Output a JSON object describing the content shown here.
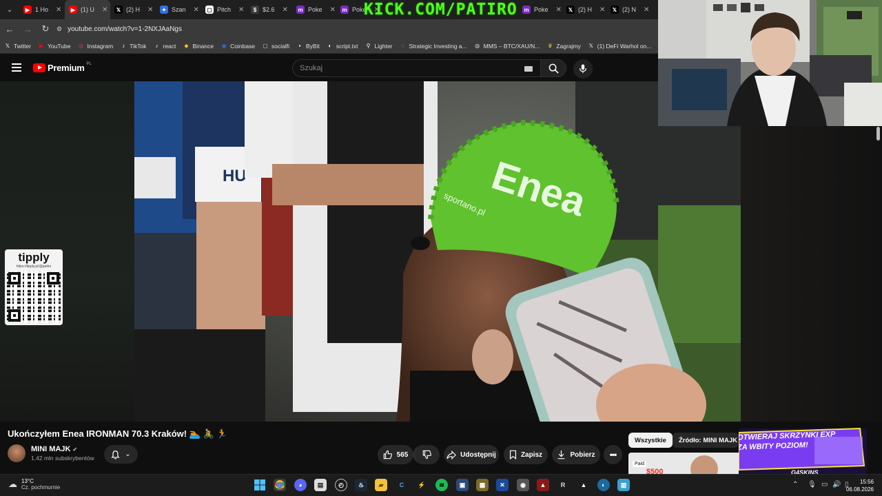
{
  "browser": {
    "tabs": [
      {
        "label": "1 Ho",
        "icon": "youtube",
        "color": "#ff0000"
      },
      {
        "label": "(1) U",
        "icon": "youtube",
        "color": "#ff0000",
        "active": true
      },
      {
        "label": "(2) H",
        "icon": "x",
        "color": "#000000"
      },
      {
        "label": "Szan",
        "icon": "star",
        "color": "#2f6fe0"
      },
      {
        "label": "Pitch",
        "icon": "doc",
        "color": "#ffffff"
      },
      {
        "label": "$2.6",
        "icon": "circle",
        "color": "#3c3c3c"
      },
      {
        "label": "Poke",
        "icon": "m",
        "color": "#7b2cbf"
      },
      {
        "label": "Poke",
        "icon": "m",
        "color": "#7b2cbf"
      },
      {
        "label": "Poke",
        "icon": "m",
        "color": "#7b2cbf"
      },
      {
        "label": "(2) H",
        "icon": "x",
        "color": "#000000"
      },
      {
        "label": "(2) N",
        "icon": "x",
        "color": "#000000"
      }
    ],
    "overlay_text": "KICK.COM/PATIRO",
    "url": "youtube.com/watch?v=1-2NXJAaNgs",
    "bookmarks": [
      "Twitter",
      "YouTube",
      "Instagram",
      "TikTok",
      "react",
      "Binance",
      "Coinbase",
      "socialfi",
      "ByBit",
      "script.txt",
      "Lighter",
      "Strategic Investing a...",
      "MMS – BTC/XAU/N...",
      "Zagrajmy",
      "(1) DeFi Warhol on..."
    ]
  },
  "youtube": {
    "logo_text": "Premium",
    "region": "PL",
    "search_placeholder": "Szukaj",
    "video_title": "Ukończyłem Enea IRONMAN 70.3 Kraków! 🏊 🚴 🏃",
    "channel_name": "MINI MAJK",
    "channel_subs": "1,42 mln subskrybentów",
    "likes": "565",
    "share_label": "Udostępnij",
    "save_label": "Zapisz",
    "download_label": "Pobierz",
    "chips": [
      "Wszystkie",
      "Źródło: MINI MAJK"
    ],
    "cap_brand": "Enea",
    "cap_url": "sportano.pl",
    "sleeve_text": "HU",
    "thumb_tag": "Paid",
    "thumb_price": "$500"
  },
  "tipply": {
    "brand": "tipply",
    "url": "https://tipply.pl/@patiro"
  },
  "ad": {
    "line1": "OTWIERAJ SKRZYNKI EXP",
    "line2": "ZA WBITY POZIOM!",
    "brand": "G4SKINS"
  },
  "taskbar": {
    "temp": "13°C",
    "weather": "Cz. pochmurnie",
    "time": "15:56",
    "date": "06.08.2026"
  }
}
